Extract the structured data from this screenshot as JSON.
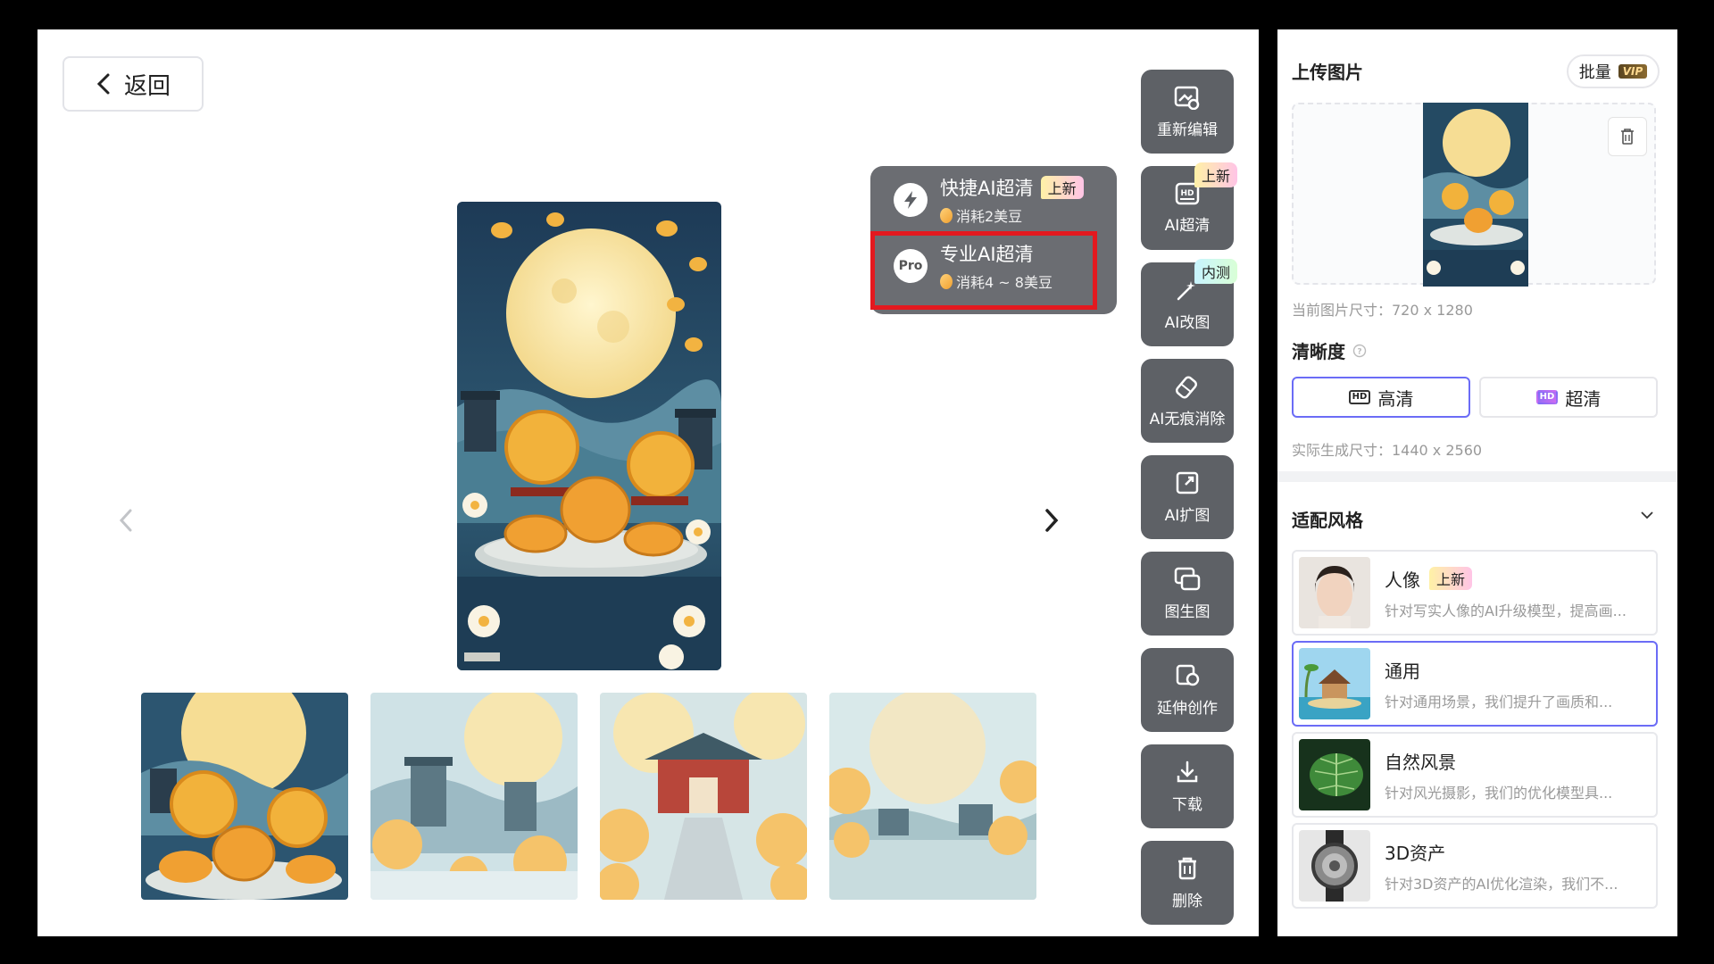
{
  "back_button": {
    "label": "返回"
  },
  "toolbar": {
    "items": [
      {
        "label": "重新编辑",
        "icon": "image-edit-icon"
      },
      {
        "label": "AI超清",
        "icon": "hd-ultra-icon",
        "badge": "上新"
      },
      {
        "label": "AI改图",
        "icon": "magic-wand-icon",
        "badge": "内测"
      },
      {
        "label": "AI无痕消除",
        "icon": "eraser-icon"
      },
      {
        "label": "AI扩图",
        "icon": "expand-icon"
      },
      {
        "label": "图生图",
        "icon": "image-to-image-icon"
      },
      {
        "label": "延伸创作",
        "icon": "extend-icon"
      },
      {
        "label": "下载",
        "icon": "download-icon"
      },
      {
        "label": "删除",
        "icon": "trash-icon"
      }
    ]
  },
  "popup": {
    "items": [
      {
        "title": "快捷AI超清",
        "badge": "上新",
        "cost": "消耗2美豆",
        "icon": "lightning-icon"
      },
      {
        "title": "专业AI超清",
        "cost": "消耗4 ~ 8美豆",
        "icon_text": "Pro"
      }
    ]
  },
  "right_panel": {
    "upload_title": "上传图片",
    "batch_label": "批量",
    "vip_label": "VIP",
    "current_size": "当前图片尺寸：720 x 1280",
    "clarity_title": "清晰度",
    "clarity_options": [
      {
        "label": "高清",
        "icon_text": "HD"
      },
      {
        "label": "超清",
        "icon_text": "HD"
      }
    ],
    "actual_size": "实际生成尺寸：1440 x 2560",
    "style_title": "适配风格",
    "styles": [
      {
        "name": "人像",
        "badge": "上新",
        "desc": "针对写实人像的AI升级模型，提高画..."
      },
      {
        "name": "通用",
        "desc": "针对通用场景，我们提升了画质和..."
      },
      {
        "name": "自然风景",
        "desc": "针对风光摄影，我们的优化模型具..."
      },
      {
        "name": "3D资产",
        "desc": "针对3D资产的AI优化渲染，我们不..."
      }
    ]
  },
  "colors": {
    "accent": "#6b6cf6",
    "highlight": "#e3191f",
    "tool_bg": "#5e6166"
  }
}
